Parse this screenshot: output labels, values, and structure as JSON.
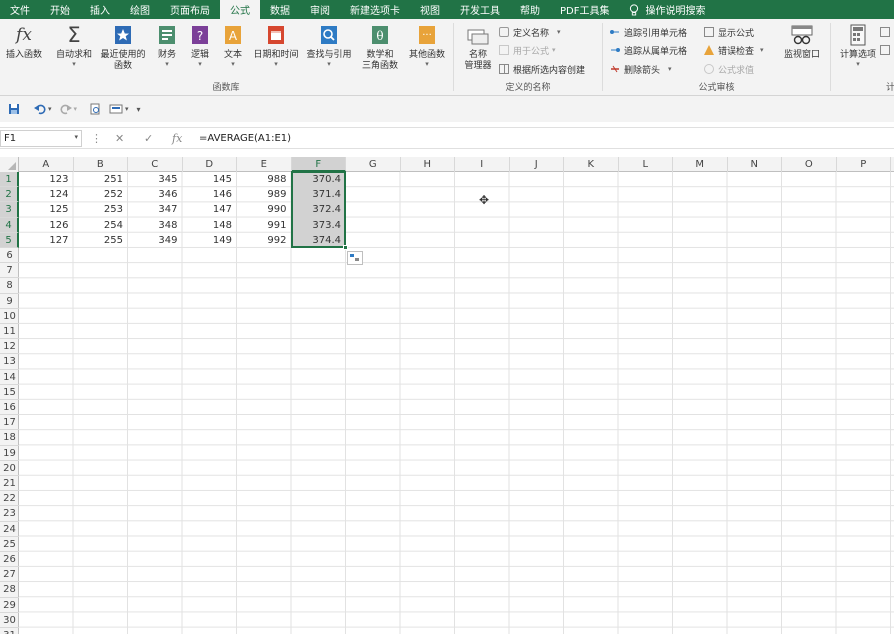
{
  "menu": {
    "tabs": [
      "文件",
      "开始",
      "插入",
      "绘图",
      "页面布局",
      "公式",
      "数据",
      "审阅",
      "新建选项卡",
      "视图",
      "开发工具",
      "帮助",
      "PDF工具集"
    ],
    "active_tab": "公式",
    "tell_me": "操作说明搜索"
  },
  "ribbon": {
    "function_library": {
      "label": "函数库",
      "insert_function": "插入函数",
      "autosum": "自动求和",
      "recent": "最近使用的\n函数",
      "financial": "财务",
      "logical": "逻辑",
      "text": "文本",
      "datetime": "日期和时间",
      "lookup": "查找与引用",
      "math": "数学和\n三角函数",
      "more": "其他函数"
    },
    "defined_names": {
      "label": "定义的名称",
      "name_manager": "名称\n管理器",
      "define_name": "定义名称",
      "use_in_formula": "用于公式",
      "create_from_selection": "根据所选内容创建"
    },
    "formula_auditing": {
      "label": "公式审核",
      "trace_precedents": "追踪引用单元格",
      "trace_dependents": "追踪从属单元格",
      "remove_arrows": "删除箭头",
      "show_formulas": "显示公式",
      "error_checking": "错误检查",
      "evaluate_formula": "公式求值",
      "watch_window": "监视窗口"
    },
    "calculation": {
      "calc_options": "计算选项",
      "label_partial": "计"
    }
  },
  "formula_bar": {
    "name_box": "F1",
    "formula": "=AVERAGE(A1:E1)",
    "fx": "fx"
  },
  "sheet": {
    "columns": [
      "A",
      "B",
      "C",
      "D",
      "E",
      "F",
      "G",
      "H",
      "I",
      "J",
      "K",
      "L",
      "M",
      "N",
      "O",
      "P"
    ],
    "selected_column": "F",
    "row_count": 31,
    "selected_rows": [
      1,
      2,
      3,
      4,
      5
    ],
    "data": [
      [
        "123",
        "251",
        "345",
        "145",
        "988",
        "370.4"
      ],
      [
        "124",
        "252",
        "346",
        "146",
        "989",
        "371.4"
      ],
      [
        "125",
        "253",
        "347",
        "147",
        "990",
        "372.4"
      ],
      [
        "126",
        "254",
        "348",
        "148",
        "991",
        "373.4"
      ],
      [
        "127",
        "255",
        "349",
        "149",
        "992",
        "374.4"
      ]
    ]
  },
  "colors": {
    "accent": "#217346",
    "selection": "#d2d2d2"
  }
}
